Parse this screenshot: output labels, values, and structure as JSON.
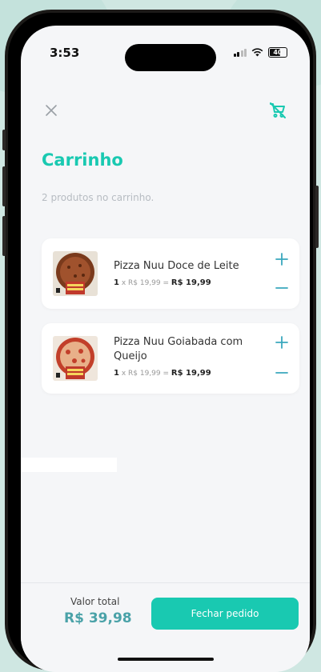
{
  "colors": {
    "accent": "#19c9b1",
    "total": "#4aa2a8",
    "muted": "#b7bcc2"
  },
  "status_bar": {
    "time": "3:53",
    "battery": "40"
  },
  "header": {
    "close_icon": "close-icon",
    "clear_cart_icon": "cart-remove-icon"
  },
  "title": "Carrinho",
  "subtitle": "2 produtos no carrinho.",
  "items": [
    {
      "name": "Pizza Nuu Doce de Leite",
      "qty": "1",
      "unit_price": "x R$ 19,99 =",
      "total": "R$ 19,99",
      "color": "#7a3a1c"
    },
    {
      "name": "Pizza Nuu Goiabada com Queijo",
      "qty": "1",
      "unit_price": "x R$ 19,99 =",
      "total": "R$ 19,99",
      "color": "#c23f2a"
    }
  ],
  "footer": {
    "total_label": "Valor total",
    "total_value": "R$ 39,98",
    "checkout_label": "Fechar pedido"
  }
}
